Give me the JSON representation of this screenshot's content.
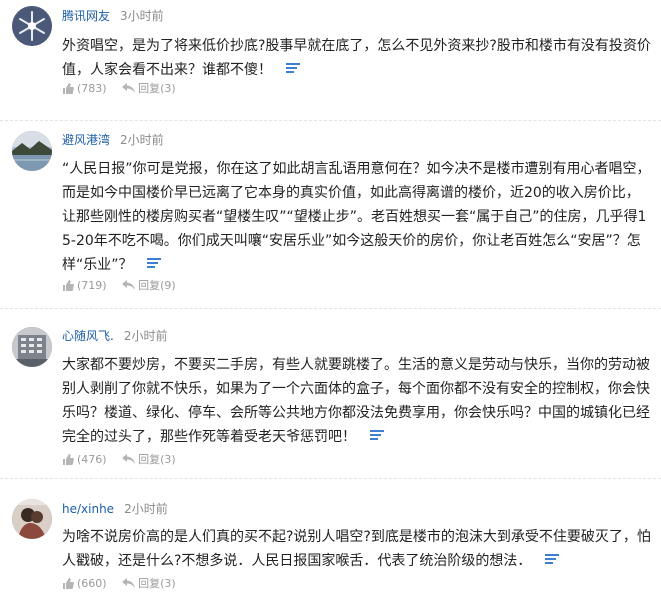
{
  "comments": [
    {
      "username": "腾讯网友",
      "time": "3小时前",
      "text": "外资唱空，是为了将来低价抄底?股事早就在底了，怎么不见外资来抄?股市和楼市有没有投资价值，人家会看不出来？谁都不傻！",
      "like_count": "(783)",
      "reply_label": "回复(3)",
      "avatar_icon": "snowflake-avatar",
      "avatar_color": "#5e6a88"
    },
    {
      "username": "避风港湾",
      "time": "2小时前",
      "text": "“人民日报”你可是党报，你在这了如此胡言乱语用意何在？如今决不是楼市遭别有用心者唱空，而是如今中国楼价早已远离了它本身的真实价值，如此高得离谱的楼价，近20的收入房价比，让那些刚性的楼房购买者“望楼生叹”“望楼止步”。老百姓想买一套“属于自己”的住房，几乎得15-20年不吃不喝。你们成天叫嚷“安居乐业”如今这般天价的房价，你让老百姓怎么“安居”？怎样“乐业”？",
      "like_count": "(719)",
      "reply_label": "回复(9)",
      "avatar_icon": "lake-landscape-avatar",
      "avatar_color": "#6f8aa6"
    },
    {
      "username": "心随风飞.",
      "time": "2小时前",
      "text": "大家都不要炒房，不要买二手房，有些人就要跳楼了。生活的意义是劳动与快乐，当你的劳动被别人剥削了你就不快乐，如果为了一个六面体的盒子，每个面你都不没有安全的控制权，你会快乐吗？楼道、绿化、停车、会所等公共地方你都没法免费享用，你会快乐吗？中国的城镇化已经完全的过头了，那些作死等着受老天爷惩罚吧！",
      "like_count": "(476)",
      "reply_label": "回复(3)",
      "avatar_icon": "building-avatar",
      "avatar_color": "#8b9097"
    },
    {
      "username": "he/xinhe",
      "time": "2小时前",
      "text": "为啥不说房价高的是人们真的买不起?说别人唱空?到底是楼市的泡沫大到承受不住要破灭了，怕人戳破，还是什么?不想多说．人民日报国家喉舌．代表了统治阶级的想法．",
      "like_count": "(660)",
      "reply_label": "回复(3)",
      "avatar_icon": "couple-photo-avatar",
      "avatar_color": "#b9a79a"
    }
  ]
}
